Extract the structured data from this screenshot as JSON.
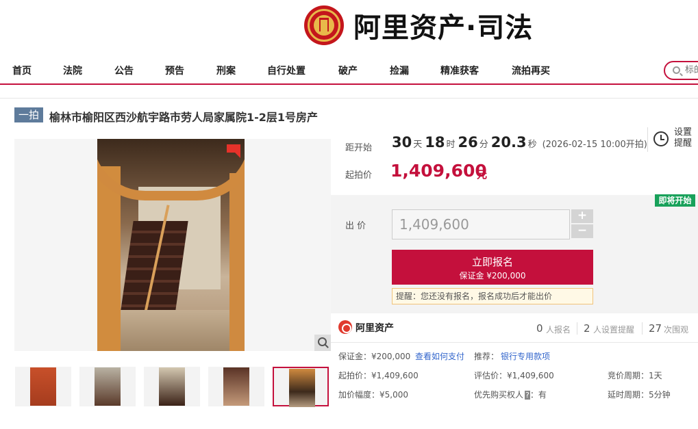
{
  "brand": {
    "name": "阿里资产·司法"
  },
  "nav": {
    "items": [
      "首页",
      "法院",
      "公告",
      "预告",
      "刑案",
      "自行处置",
      "破产",
      "捡漏",
      "精准获客",
      "流拍再买"
    ],
    "search_placeholder": "标的"
  },
  "item": {
    "round_badge": "一拍",
    "title": "榆林市榆阳区西沙航宇路市劳人局家属院1-2层1号房产"
  },
  "countdown": {
    "label": "距开始",
    "days": "30",
    "days_unit": "天",
    "hours": "18",
    "hours_unit": "时",
    "minutes": "26",
    "minutes_unit": "分",
    "seconds": "20.3",
    "seconds_unit": "秒",
    "start_note": "(2026-02-15 10:00开拍)",
    "remind_label": "设置提醒"
  },
  "start_price": {
    "label": "起拍价",
    "value": "1,409,600",
    "unit": "元"
  },
  "bid": {
    "soon_tag": "即将开始",
    "label": "出 价",
    "input_value": "1,409,600",
    "plus": "+",
    "minus": "−",
    "apply_label": "立即报名",
    "deposit_label": "保证金 ¥200,000",
    "tip": "提醒：您还没有报名，报名成功后才能出价"
  },
  "stats": {
    "org": "阿里资产",
    "registered_count": "0",
    "registered_label": "人报名",
    "reminder_count": "2",
    "reminder_label": "人设置提醒",
    "views_count": "27",
    "views_label": "次围观"
  },
  "info": {
    "deposit": "保证金：¥200,000",
    "pay_link": "查看如何支付",
    "recommend_label": "推荐：",
    "bank_link": "银行专用款项",
    "start_price": "起拍价：¥1,409,600",
    "appraisal": "评估价：¥1,409,600",
    "cycle": "竞价周期：1天",
    "increment": "加价幅度：¥5,000",
    "priority": "优先购买权人",
    "priority_badge": "?",
    "priority_value": "：有",
    "delay": "延时周期：5分钟"
  },
  "colors": {
    "accent": "#c4103c",
    "badge": "#5e7b9b",
    "soon": "#18a15a",
    "link": "#3366cc"
  },
  "icons": {
    "remind": "clock-icon",
    "search": "search-icon",
    "zoom": "zoom-icon",
    "org": "alibaba-logo-icon"
  }
}
